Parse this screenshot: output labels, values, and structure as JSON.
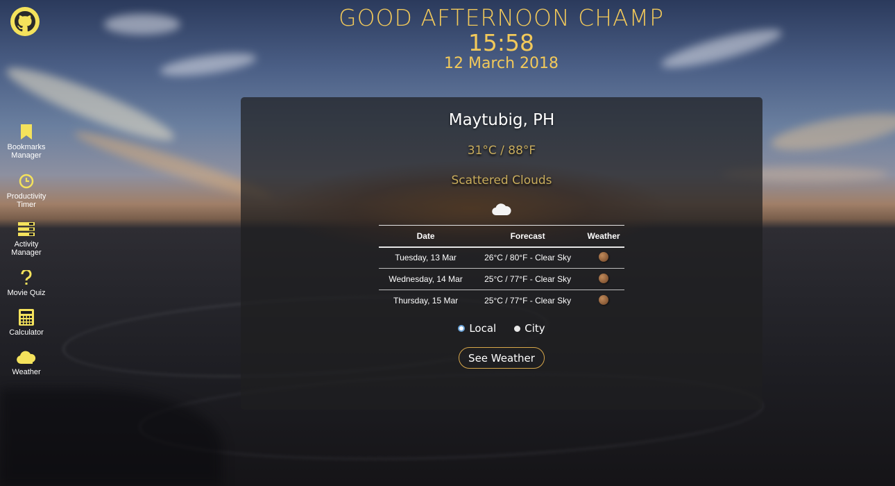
{
  "header": {
    "greeting": "GOOD AFTERNOON CHAMP",
    "time": "15:58",
    "date": "12 March 2018"
  },
  "sidebar": {
    "items": [
      {
        "label": "Bookmarks\nManager",
        "icon": "bookmark-icon"
      },
      {
        "label": "Productivity\nTimer",
        "icon": "clock-icon"
      },
      {
        "label": "Activity\nManager",
        "icon": "list-icon"
      },
      {
        "label": "Movie Quiz",
        "icon": "question-icon"
      },
      {
        "label": "Calculator",
        "icon": "calculator-icon"
      },
      {
        "label": "Weather",
        "icon": "cloud-icon"
      }
    ]
  },
  "weather": {
    "location": "Maytubig, PH",
    "temperature": "31°C / 88°F",
    "description": "Scattered Clouds",
    "icon": "cloud-icon",
    "table": {
      "headers": [
        "Date",
        "Forecast",
        "Weather"
      ],
      "rows": [
        {
          "date": "Tuesday, 13 Mar",
          "forecast": "26°C / 80°F - Clear Sky",
          "icon": "moon-icon"
        },
        {
          "date": "Wednesday, 14 Mar",
          "forecast": "25°C / 77°F - Clear Sky",
          "icon": "moon-icon"
        },
        {
          "date": "Thursday, 15 Mar",
          "forecast": "25°C / 77°F - Clear Sky",
          "icon": "moon-icon"
        }
      ]
    },
    "radio": {
      "local": "Local",
      "city": "City",
      "selected": "Local"
    },
    "button": "See Weather"
  },
  "colors": {
    "accent": "#f2c95a",
    "icon_yellow": "#f4e25c",
    "button_border": "#d9a84a"
  }
}
